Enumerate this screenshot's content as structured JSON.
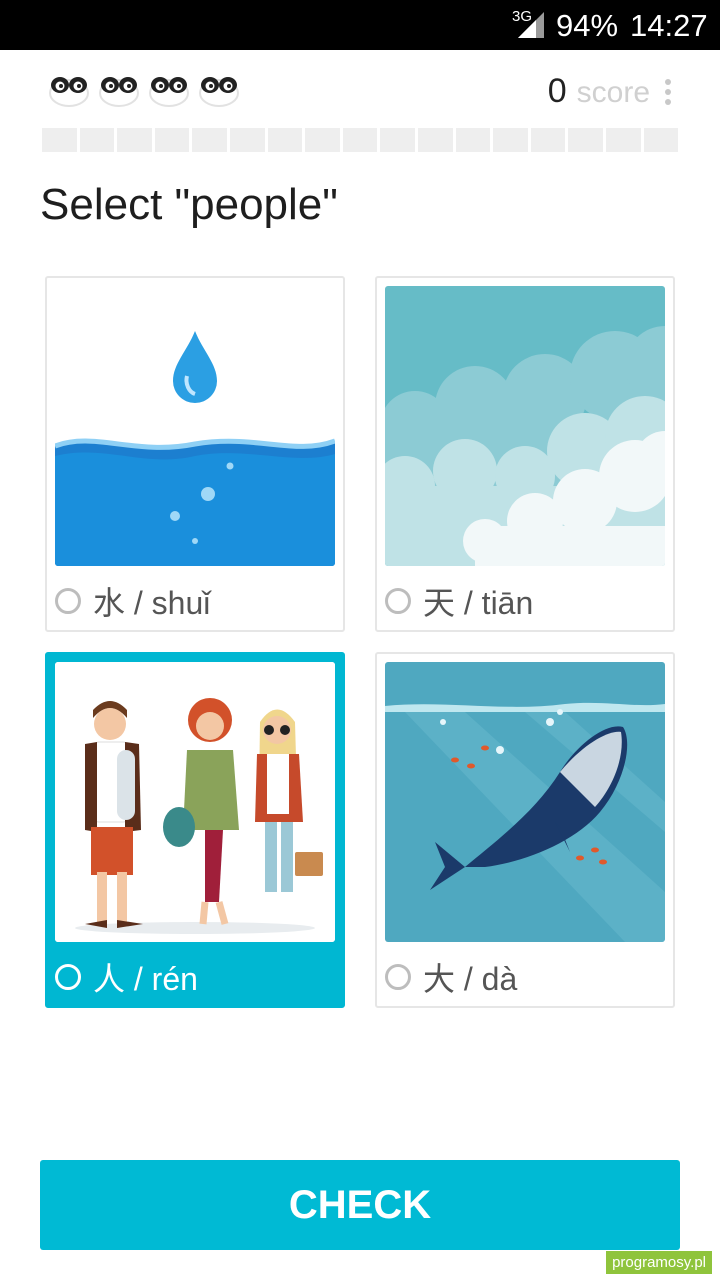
{
  "status_bar": {
    "network": "3G",
    "battery": "94%",
    "time": "14:27"
  },
  "header": {
    "lives": [
      "panda-life-icon",
      "panda-life-icon",
      "panda-life-icon",
      "panda-life-icon"
    ],
    "score_value": "0",
    "score_label": "score",
    "menu_icon": "more-vertical-icon",
    "progress": {
      "segments": 17,
      "completed": 0
    }
  },
  "question": {
    "prompt": "Select \"people\""
  },
  "options": [
    {
      "char": "水",
      "pinyin": "shuǐ",
      "label": "水 / shuǐ",
      "image": "water-drop-image",
      "selected": false
    },
    {
      "char": "天",
      "pinyin": "tiān",
      "label": "天 / tiān",
      "image": "sky-clouds-image",
      "selected": false
    },
    {
      "char": "人",
      "pinyin": "rén",
      "label": "人 / rén",
      "image": "people-image",
      "selected": true
    },
    {
      "char": "大",
      "pinyin": "dà",
      "label": "大 / dà",
      "image": "whale-image",
      "selected": false
    }
  ],
  "actions": {
    "check_label": "CHECK"
  },
  "watermark": "programosy.pl",
  "colors": {
    "accent": "#00bad4",
    "selected_card": "#00b7d2",
    "status_bar": "#000000"
  }
}
